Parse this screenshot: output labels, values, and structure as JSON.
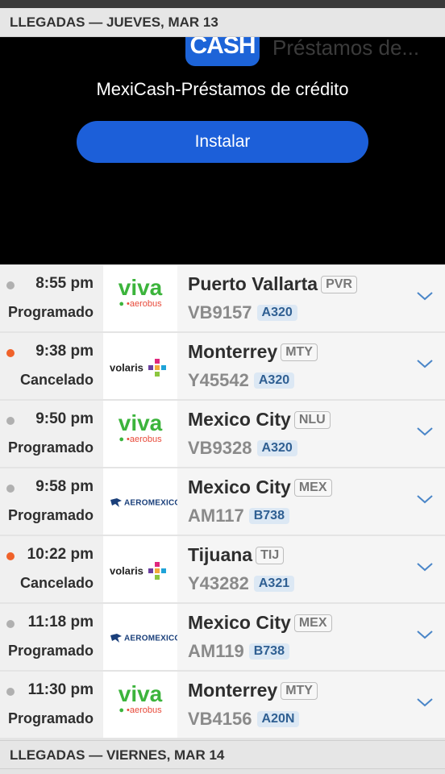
{
  "header_top": "LLEGADAS — JUEVES, MAR 13",
  "header_bottom": "LLEGADAS — VIERNES, MAR 14",
  "ad": {
    "icon_text": "CASH",
    "ghost_title": "Préstamos de...",
    "app_name": "MexiCash-Préstamos de crédito",
    "button": "Instalar"
  },
  "colors": {
    "scheduled_dot": "#b0b0b0",
    "cancelled_dot": "#f0622a",
    "ad_button": "#1c5fd9"
  },
  "flights": [
    {
      "time": "8:55 pm",
      "status": "Programado",
      "status_dot": "gray",
      "airline_logo": "viva-aerobus-logo",
      "airline_text": "viva",
      "airline_sub": "aerobus",
      "city": "Puerto Vallarta",
      "code": "PVR",
      "flight": "VB9157",
      "aircraft": "A320"
    },
    {
      "time": "9:38 pm",
      "status": "Cancelado",
      "status_dot": "orange",
      "airline_logo": "volaris-logo",
      "airline_text": "volaris",
      "city": "Monterrey",
      "code": "MTY",
      "flight": "Y45542",
      "aircraft": "A320"
    },
    {
      "time": "9:50 pm",
      "status": "Programado",
      "status_dot": "gray",
      "airline_logo": "viva-aerobus-logo",
      "airline_text": "viva",
      "airline_sub": "aerobus",
      "city": "Mexico City",
      "code": "NLU",
      "flight": "VB9328",
      "aircraft": "A320"
    },
    {
      "time": "9:58 pm",
      "status": "Programado",
      "status_dot": "gray",
      "airline_logo": "aeromexico-logo",
      "airline_text": "AEROMEXICO",
      "city": "Mexico City",
      "code": "MEX",
      "flight": "AM117",
      "aircraft": "B738"
    },
    {
      "time": "10:22 pm",
      "status": "Cancelado",
      "status_dot": "orange",
      "airline_logo": "volaris-logo",
      "airline_text": "volaris",
      "city": "Tijuana",
      "code": "TIJ",
      "flight": "Y43282",
      "aircraft": "A321"
    },
    {
      "time": "11:18 pm",
      "status": "Programado",
      "status_dot": "gray",
      "airline_logo": "aeromexico-logo",
      "airline_text": "AEROMEXICO",
      "city": "Mexico City",
      "code": "MEX",
      "flight": "AM119",
      "aircraft": "B738"
    },
    {
      "time": "11:30 pm",
      "status": "Programado",
      "status_dot": "gray",
      "airline_logo": "viva-aerobus-logo",
      "airline_text": "viva",
      "airline_sub": "aerobus",
      "city": "Monterrey",
      "code": "MTY",
      "flight": "VB4156",
      "aircraft": "A20N"
    }
  ]
}
